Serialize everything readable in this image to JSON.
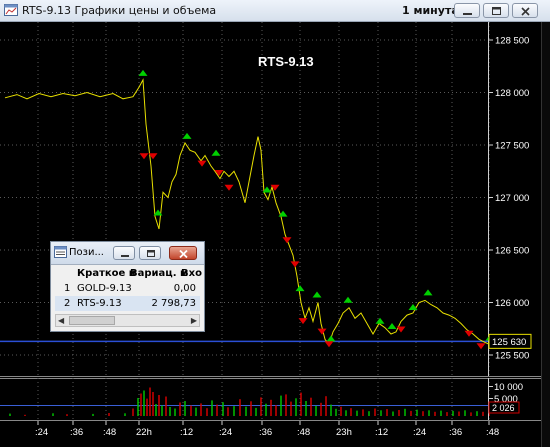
{
  "window": {
    "title": "RTS-9.13 Графики цены и объема",
    "interval": "1 минута",
    "colors": {
      "price_line": "#e8e000",
      "buy_marker": "#00d000",
      "sell_marker": "#e00000",
      "current_price_line": "#2b4fd6",
      "grid": "#6a6a6a"
    }
  },
  "chart": {
    "label": "RTS-9.13",
    "current_price": "125 630",
    "yticks": [
      "128 500",
      "128 000",
      "127 500",
      "127 000",
      "126 500",
      "126 000",
      "125 500"
    ],
    "volume_ticks": [
      "10 000",
      "5 000"
    ],
    "volume_current": "2 026",
    "time_ticks": [
      ":24",
      ":36",
      ":48",
      "22h",
      ":12",
      ":24",
      ":36",
      ":48",
      "23h",
      ":12",
      ":24",
      ":36",
      ":48"
    ]
  },
  "chart_data": {
    "type": "line",
    "title": "RTS-9.13",
    "ylim": [
      125350,
      128650
    ],
    "price_path": [
      {
        "x": 0,
        "y": 127950
      },
      {
        "x": 12,
        "y": 127980
      },
      {
        "x": 22,
        "y": 127940
      },
      {
        "x": 34,
        "y": 127990
      },
      {
        "x": 46,
        "y": 127960
      },
      {
        "x": 58,
        "y": 127990
      },
      {
        "x": 70,
        "y": 127970
      },
      {
        "x": 82,
        "y": 128000
      },
      {
        "x": 95,
        "y": 127960
      },
      {
        "x": 108,
        "y": 127990
      },
      {
        "x": 118,
        "y": 127940
      },
      {
        "x": 128,
        "y": 127960
      },
      {
        "x": 134,
        "y": 128050
      },
      {
        "x": 138,
        "y": 128120
      },
      {
        "x": 141,
        "y": 127700
      },
      {
        "x": 146,
        "y": 127300
      },
      {
        "x": 150,
        "y": 126820
      },
      {
        "x": 154,
        "y": 126700
      },
      {
        "x": 158,
        "y": 127050
      },
      {
        "x": 163,
        "y": 127000
      },
      {
        "x": 167,
        "y": 127150
      },
      {
        "x": 171,
        "y": 127220
      },
      {
        "x": 175,
        "y": 127400
      },
      {
        "x": 180,
        "y": 127520
      },
      {
        "x": 185,
        "y": 127450
      },
      {
        "x": 190,
        "y": 127430
      },
      {
        "x": 196,
        "y": 127350
      },
      {
        "x": 200,
        "y": 127400
      },
      {
        "x": 206,
        "y": 127300
      },
      {
        "x": 210,
        "y": 127250
      },
      {
        "x": 215,
        "y": 127180
      },
      {
        "x": 219,
        "y": 127250
      },
      {
        "x": 224,
        "y": 127200
      },
      {
        "x": 229,
        "y": 127250
      },
      {
        "x": 234,
        "y": 127150
      },
      {
        "x": 240,
        "y": 126950
      },
      {
        "x": 245,
        "y": 127200
      },
      {
        "x": 249,
        "y": 127400
      },
      {
        "x": 253,
        "y": 127580
      },
      {
        "x": 256,
        "y": 127450
      },
      {
        "x": 259,
        "y": 127050
      },
      {
        "x": 263,
        "y": 126980
      },
      {
        "x": 267,
        "y": 127100
      },
      {
        "x": 271,
        "y": 126950
      },
      {
        "x": 276,
        "y": 126820
      },
      {
        "x": 280,
        "y": 126650
      },
      {
        "x": 284,
        "y": 126550
      },
      {
        "x": 288,
        "y": 126450
      },
      {
        "x": 292,
        "y": 126250
      },
      {
        "x": 296,
        "y": 126000
      },
      {
        "x": 300,
        "y": 125850
      },
      {
        "x": 304,
        "y": 125950
      },
      {
        "x": 308,
        "y": 125820
      },
      {
        "x": 313,
        "y": 126000
      },
      {
        "x": 316,
        "y": 125800
      },
      {
        "x": 320,
        "y": 125650
      },
      {
        "x": 324,
        "y": 125600
      },
      {
        "x": 328,
        "y": 125720
      },
      {
        "x": 333,
        "y": 125800
      },
      {
        "x": 338,
        "y": 125900
      },
      {
        "x": 344,
        "y": 125950
      },
      {
        "x": 350,
        "y": 125850
      },
      {
        "x": 356,
        "y": 125900
      },
      {
        "x": 362,
        "y": 125800
      },
      {
        "x": 368,
        "y": 125700
      },
      {
        "x": 374,
        "y": 125800
      },
      {
        "x": 380,
        "y": 125760
      },
      {
        "x": 386,
        "y": 125700
      },
      {
        "x": 391,
        "y": 125720
      },
      {
        "x": 396,
        "y": 125820
      },
      {
        "x": 402,
        "y": 125880
      },
      {
        "x": 408,
        "y": 125900
      },
      {
        "x": 414,
        "y": 126000
      },
      {
        "x": 420,
        "y": 126020
      },
      {
        "x": 426,
        "y": 125980
      },
      {
        "x": 432,
        "y": 125950
      },
      {
        "x": 438,
        "y": 125900
      },
      {
        "x": 444,
        "y": 125880
      },
      {
        "x": 450,
        "y": 125850
      },
      {
        "x": 456,
        "y": 125800
      },
      {
        "x": 462,
        "y": 125740
      },
      {
        "x": 468,
        "y": 125700
      },
      {
        "x": 474,
        "y": 125650
      },
      {
        "x": 480,
        "y": 125620
      },
      {
        "x": 485,
        "y": 125600
      }
    ],
    "buy_markers": [
      {
        "x": 138,
        "y": 128120
      },
      {
        "x": 153,
        "y": 126790
      },
      {
        "x": 182,
        "y": 127520
      },
      {
        "x": 211,
        "y": 127360
      },
      {
        "x": 262,
        "y": 127010
      },
      {
        "x": 278,
        "y": 126780
      },
      {
        "x": 295,
        "y": 126070
      },
      {
        "x": 312,
        "y": 126010
      },
      {
        "x": 326,
        "y": 125590
      },
      {
        "x": 343,
        "y": 125960
      },
      {
        "x": 375,
        "y": 125760
      },
      {
        "x": 387,
        "y": 125710
      },
      {
        "x": 408,
        "y": 125890
      },
      {
        "x": 423,
        "y": 126030
      },
      {
        "x": 485,
        "y": 125600
      }
    ],
    "sell_markers": [
      {
        "x": 139,
        "y": 127450
      },
      {
        "x": 148,
        "y": 127450
      },
      {
        "x": 197,
        "y": 127380
      },
      {
        "x": 214,
        "y": 127290
      },
      {
        "x": 224,
        "y": 127150
      },
      {
        "x": 270,
        "y": 127150
      },
      {
        "x": 282,
        "y": 126650
      },
      {
        "x": 290,
        "y": 126420
      },
      {
        "x": 298,
        "y": 125880
      },
      {
        "x": 317,
        "y": 125780
      },
      {
        "x": 324,
        "y": 125660
      },
      {
        "x": 396,
        "y": 125800
      },
      {
        "x": 464,
        "y": 125760
      },
      {
        "x": 476,
        "y": 125640
      }
    ],
    "volume": {
      "ylim": [
        0,
        12000
      ],
      "bars": [
        {
          "x": 5,
          "v": 800,
          "c": "g"
        },
        {
          "x": 20,
          "v": 400,
          "c": "r"
        },
        {
          "x": 48,
          "v": 900,
          "c": "g"
        },
        {
          "x": 62,
          "v": 600,
          "c": "r"
        },
        {
          "x": 88,
          "v": 700,
          "c": "g"
        },
        {
          "x": 104,
          "v": 1000,
          "c": "r"
        },
        {
          "x": 120,
          "v": 900,
          "c": "g"
        },
        {
          "x": 128,
          "v": 2500,
          "c": "r"
        },
        {
          "x": 133,
          "v": 6000,
          "c": "g"
        },
        {
          "x": 136,
          "v": 7500,
          "c": "r"
        },
        {
          "x": 139,
          "v": 8500,
          "c": "g"
        },
        {
          "x": 142,
          "v": 5800,
          "c": "r"
        },
        {
          "x": 145,
          "v": 9500,
          "c": "r"
        },
        {
          "x": 148,
          "v": 8000,
          "c": "r"
        },
        {
          "x": 151,
          "v": 4000,
          "c": "g"
        },
        {
          "x": 154,
          "v": 7000,
          "c": "r"
        },
        {
          "x": 157,
          "v": 3500,
          "c": "g"
        },
        {
          "x": 161,
          "v": 6500,
          "c": "r"
        },
        {
          "x": 165,
          "v": 3000,
          "c": "g"
        },
        {
          "x": 170,
          "v": 2500,
          "c": "g"
        },
        {
          "x": 175,
          "v": 4500,
          "c": "r"
        },
        {
          "x": 180,
          "v": 5000,
          "c": "g"
        },
        {
          "x": 186,
          "v": 3500,
          "c": "r"
        },
        {
          "x": 191,
          "v": 2800,
          "c": "g"
        },
        {
          "x": 196,
          "v": 4200,
          "c": "r"
        },
        {
          "x": 202,
          "v": 2600,
          "c": "r"
        },
        {
          "x": 207,
          "v": 5200,
          "c": "g"
        },
        {
          "x": 212,
          "v": 3800,
          "c": "r"
        },
        {
          "x": 218,
          "v": 4600,
          "c": "g"
        },
        {
          "x": 223,
          "v": 2900,
          "c": "r"
        },
        {
          "x": 229,
          "v": 3300,
          "c": "g"
        },
        {
          "x": 235,
          "v": 5600,
          "c": "r"
        },
        {
          "x": 241,
          "v": 3100,
          "c": "g"
        },
        {
          "x": 246,
          "v": 4900,
          "c": "r"
        },
        {
          "x": 251,
          "v": 2700,
          "c": "g"
        },
        {
          "x": 256,
          "v": 6200,
          "c": "r"
        },
        {
          "x": 261,
          "v": 4100,
          "c": "g"
        },
        {
          "x": 266,
          "v": 5400,
          "c": "r"
        },
        {
          "x": 271,
          "v": 3600,
          "c": "r"
        },
        {
          "x": 276,
          "v": 6800,
          "c": "g"
        },
        {
          "x": 281,
          "v": 7200,
          "c": "r"
        },
        {
          "x": 286,
          "v": 4800,
          "c": "r"
        },
        {
          "x": 291,
          "v": 5900,
          "c": "g"
        },
        {
          "x": 296,
          "v": 7800,
          "c": "r"
        },
        {
          "x": 301,
          "v": 5000,
          "c": "g"
        },
        {
          "x": 306,
          "v": 6100,
          "c": "r"
        },
        {
          "x": 311,
          "v": 3400,
          "c": "g"
        },
        {
          "x": 316,
          "v": 4400,
          "c": "r"
        },
        {
          "x": 321,
          "v": 6600,
          "c": "r"
        },
        {
          "x": 326,
          "v": 3800,
          "c": "g"
        },
        {
          "x": 331,
          "v": 2400,
          "c": "g"
        },
        {
          "x": 336,
          "v": 3100,
          "c": "r"
        },
        {
          "x": 341,
          "v": 1900,
          "c": "g"
        },
        {
          "x": 346,
          "v": 2600,
          "c": "r"
        },
        {
          "x": 352,
          "v": 1800,
          "c": "g"
        },
        {
          "x": 358,
          "v": 2200,
          "c": "r"
        },
        {
          "x": 364,
          "v": 1600,
          "c": "g"
        },
        {
          "x": 370,
          "v": 2500,
          "c": "r"
        },
        {
          "x": 376,
          "v": 1900,
          "c": "g"
        },
        {
          "x": 382,
          "v": 2300,
          "c": "r"
        },
        {
          "x": 388,
          "v": 1500,
          "c": "g"
        },
        {
          "x": 394,
          "v": 2000,
          "c": "r"
        },
        {
          "x": 400,
          "v": 2400,
          "c": "g"
        },
        {
          "x": 406,
          "v": 1700,
          "c": "r"
        },
        {
          "x": 412,
          "v": 2100,
          "c": "g"
        },
        {
          "x": 418,
          "v": 1600,
          "c": "r"
        },
        {
          "x": 424,
          "v": 1900,
          "c": "g"
        },
        {
          "x": 430,
          "v": 1400,
          "c": "r"
        },
        {
          "x": 436,
          "v": 1800,
          "c": "g"
        },
        {
          "x": 442,
          "v": 1300,
          "c": "r"
        },
        {
          "x": 448,
          "v": 1700,
          "c": "g"
        },
        {
          "x": 454,
          "v": 1500,
          "c": "r"
        },
        {
          "x": 460,
          "v": 1900,
          "c": "g"
        },
        {
          "x": 466,
          "v": 1200,
          "c": "r"
        },
        {
          "x": 472,
          "v": 1600,
          "c": "g"
        },
        {
          "x": 478,
          "v": 1400,
          "c": "r"
        },
        {
          "x": 484,
          "v": 2026,
          "c": "r"
        }
      ]
    }
  },
  "dialog": {
    "title": "Пози...",
    "headers": [
      "Краткое н",
      "Вариац. м",
      "Вхо"
    ],
    "rows": [
      {
        "num": "1",
        "name": "GOLD-9.13",
        "value": "0,00"
      },
      {
        "num": "2",
        "name": "RTS-9.13",
        "value": "2 798,73"
      }
    ]
  }
}
